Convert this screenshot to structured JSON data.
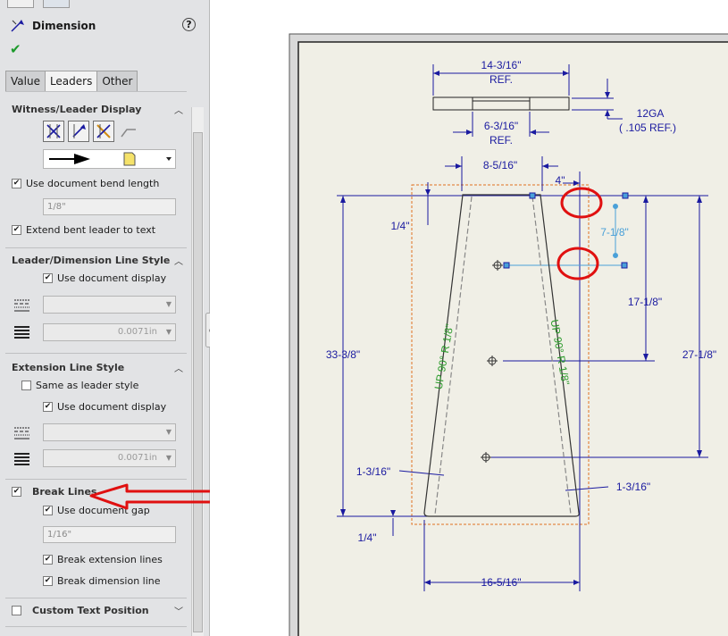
{
  "panel": {
    "title": "Dimension",
    "help_icon": "question-icon",
    "ok_icon": "checkmark-icon",
    "tabs": [
      "Value",
      "Leaders",
      "Other"
    ],
    "active_tab": "Leaders",
    "sections": {
      "witness": {
        "title": "Witness/Leader Display",
        "bend_checkbox": "Use document bend length",
        "bend_value": "1/8\"",
        "extend_checkbox": "Extend bent leader to text"
      },
      "leader_style": {
        "title": "Leader/Dimension Line Style",
        "use_doc": "Use document display",
        "thickness": "0.0071in"
      },
      "extension_style": {
        "title": "Extension Line Style",
        "same_as": "Same as leader style",
        "use_doc": "Use document display",
        "thickness": "0.0071in"
      },
      "break_lines": {
        "title": "Break Lines",
        "use_gap": "Use document gap",
        "gap_value": "1/16\"",
        "break_ext": "Break extension lines",
        "break_dim": "Break dimension line"
      },
      "custom_text": {
        "title": "Custom Text Position"
      }
    }
  },
  "drawing": {
    "dims": {
      "top_width": "14-3/16\"",
      "ref1": "REF.",
      "inner_width": "6-3/16\"",
      "ref2": "REF.",
      "gauge": "12GA",
      "gauge_ref": "( .105 REF.)",
      "top_flat": "8-5/16\"",
      "small": "4\"",
      "quarter_top": "1/4\"",
      "hole_spacing": "7-1/8\"",
      "height_right_upper": "17-1/8\"",
      "height_left": "33-3/8\"",
      "height_right": "27-1/8\"",
      "bend_left": "1-3/16\"",
      "bend_right": "1-3/16\"",
      "quarter_bottom": "1/4\"",
      "bottom_width": "16-5/16\""
    },
    "bend_left_note": "UP 90° R 1/8\"",
    "bend_right_note": "UP 90° R 1/8\"",
    "colors": {
      "dimension": "#1a1aa0",
      "bend_note": "#2a9a2a",
      "annotation": "#e01010",
      "bbox": "#e07020",
      "sheet": "#f0efe6"
    }
  }
}
